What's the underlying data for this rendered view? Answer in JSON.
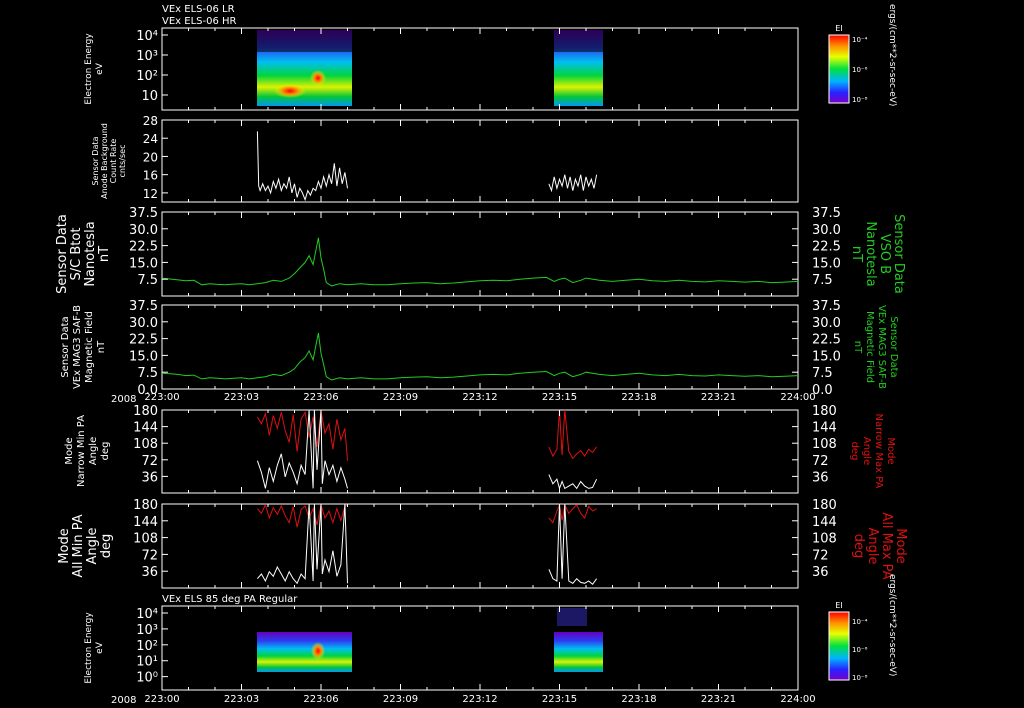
{
  "header": {
    "line1": "VEx ELS-06 LR",
    "line2": "VEx ELS-06 HR"
  },
  "colors": {
    "frame": "#ffffff",
    "green": "#22cc22",
    "red": "#dd1111",
    "background": "#000000"
  },
  "colorbar": {
    "title": "EI",
    "ticks": [
      "10⁻⁴",
      "10⁻⁶",
      "10⁻⁸"
    ],
    "unit": "ergs/(cm**2-sr-sec-eV)"
  },
  "chart_data": [
    {
      "type": "heatmap",
      "ylabel": [
        "Electron Energy",
        "eV"
      ],
      "log_y": true,
      "y_ticks": [
        "10⁴",
        "10³",
        "10²",
        "10"
      ],
      "intervals": [
        [
          "223:03.6",
          "223:07.0"
        ],
        [
          "223:14.6",
          "223:16.4"
        ]
      ],
      "colorbar": "EI"
    },
    {
      "type": "line",
      "ylabel": [
        "Sensor Data",
        "Anode Background",
        "Count Rate",
        "cnts/sec"
      ],
      "ylim": [
        10,
        28
      ],
      "y_ticks": [
        12,
        16,
        20,
        24,
        28
      ],
      "series": [
        {
          "color": "#ffffff",
          "x": [
            3.6,
            3.65,
            3.7,
            3.8,
            3.9,
            4.0,
            4.1,
            4.2,
            4.3,
            4.4,
            4.5,
            4.6,
            4.7,
            4.8,
            4.9,
            5.0,
            5.1,
            5.2,
            5.3,
            5.4,
            5.5,
            5.6,
            5.7,
            5.8,
            5.9,
            6.0,
            6.1,
            6.2,
            6.3,
            6.4,
            6.5,
            6.6,
            6.7,
            6.8,
            6.9,
            7.0
          ],
          "y": [
            25.5,
            13.5,
            12.5,
            14.0,
            12.5,
            13.5,
            12.0,
            14.5,
            13.0,
            15.0,
            12.5,
            14.0,
            13.0,
            15.5,
            12.0,
            14.0,
            11.0,
            13.0,
            12.0,
            10.5,
            12.5,
            11.5,
            13.0,
            12.5,
            14.5,
            13.0,
            15.5,
            13.5,
            16.0,
            14.0,
            18.5,
            13.5,
            17.5,
            14.0,
            16.5,
            13.0
          ]
        },
        {
          "color": "#ffffff",
          "x": [
            14.6,
            14.7,
            14.8,
            14.9,
            15.0,
            15.1,
            15.2,
            15.3,
            15.4,
            15.5,
            15.6,
            15.7,
            15.8,
            15.9,
            16.0,
            16.1,
            16.2,
            16.3,
            16.4
          ],
          "y": [
            14.0,
            12.5,
            15.5,
            13.0,
            15.0,
            13.5,
            16.0,
            13.0,
            15.5,
            12.5,
            15.0,
            13.5,
            16.0,
            12.5,
            15.5,
            13.5,
            15.0,
            13.0,
            16.0
          ]
        }
      ]
    },
    {
      "type": "line",
      "ylabel": [
        "Sensor Data",
        "S/C Btot",
        "Nanotesla",
        "nT"
      ],
      "ylabel_right": [
        "Sensor Data",
        "VSO B",
        "Nanotesla",
        "nT"
      ],
      "ylim": [
        0,
        37.5
      ],
      "y_ticks": [
        "7.5",
        "15.0",
        "22.5",
        "30.0",
        "37.5"
      ],
      "series": [
        {
          "color": "#22cc22",
          "x": [
            0.0,
            0.3,
            0.6,
            0.9,
            1.2,
            1.5,
            1.8,
            2.1,
            2.4,
            2.7,
            3.0,
            3.3,
            3.6,
            3.9,
            4.2,
            4.5,
            4.8,
            5.0,
            5.2,
            5.4,
            5.55,
            5.7,
            5.8,
            5.9,
            6.0,
            6.1,
            6.2,
            6.4,
            6.7,
            7.0,
            7.5,
            8.0,
            8.5,
            9.0,
            9.5,
            10.0,
            10.5,
            11.0,
            11.5,
            12.0,
            12.5,
            13.0,
            13.5,
            14.0,
            14.5,
            14.8,
            15.0,
            15.2,
            15.5,
            15.8,
            16.0,
            16.5,
            17.0,
            17.5,
            18.0,
            18.5,
            19.0,
            19.5,
            20.0,
            20.5,
            21.0,
            21.5,
            22.0,
            22.5,
            23.0,
            23.5,
            24.0
          ],
          "y": [
            8.0,
            7.6,
            7.2,
            6.8,
            7.0,
            5.0,
            5.5,
            5.2,
            5.0,
            5.3,
            5.5,
            5.0,
            5.5,
            6.0,
            7.0,
            6.5,
            8.0,
            10.0,
            12.5,
            15.0,
            18.0,
            14.0,
            20.0,
            26.0,
            17.0,
            12.0,
            6.0,
            4.5,
            5.5,
            5.0,
            5.5,
            5.0,
            5.0,
            5.5,
            5.8,
            6.0,
            5.5,
            5.8,
            6.3,
            6.8,
            7.0,
            6.8,
            7.5,
            8.0,
            8.3,
            6.5,
            7.5,
            8.0,
            6.0,
            7.0,
            8.0,
            7.0,
            6.5,
            7.0,
            7.5,
            6.8,
            6.5,
            7.0,
            6.5,
            6.3,
            6.8,
            6.5,
            6.2,
            6.5,
            6.0,
            6.2,
            6.5
          ]
        }
      ]
    },
    {
      "type": "line",
      "ylabel": [
        "Sensor Data",
        "VEx MAG3 SAF-B",
        "Magnetic Field",
        "nT"
      ],
      "ylabel_right": [
        "Sensor Data",
        "VEx MAG3 SAF-B",
        "Magnetic Field",
        "nT"
      ],
      "ylim": [
        0,
        37.5
      ],
      "y_ticks": [
        "0.0",
        "7.5",
        "15.0",
        "22.5",
        "30.0",
        "37.5"
      ],
      "series": [
        {
          "color": "#22cc22",
          "x": [
            0.0,
            0.3,
            0.6,
            0.9,
            1.2,
            1.5,
            1.8,
            2.1,
            2.4,
            2.7,
            3.0,
            3.3,
            3.6,
            3.9,
            4.2,
            4.5,
            4.8,
            5.0,
            5.2,
            5.4,
            5.55,
            5.7,
            5.8,
            5.9,
            6.0,
            6.1,
            6.2,
            6.4,
            6.7,
            7.0,
            7.5,
            8.0,
            8.5,
            9.0,
            9.5,
            10.0,
            10.5,
            11.0,
            11.5,
            12.0,
            12.5,
            13.0,
            13.5,
            14.0,
            14.5,
            14.8,
            15.0,
            15.2,
            15.5,
            15.8,
            16.0,
            16.5,
            17.0,
            17.5,
            18.0,
            18.5,
            19.0,
            19.5,
            20.0,
            20.5,
            21.0,
            21.5,
            22.0,
            22.5,
            23.0,
            23.5,
            24.0
          ],
          "y": [
            7.0,
            6.8,
            6.5,
            6.0,
            6.2,
            4.5,
            5.0,
            4.8,
            4.5,
            4.8,
            5.0,
            4.5,
            5.0,
            5.5,
            6.5,
            6.0,
            7.5,
            9.0,
            12.0,
            14.0,
            17.0,
            13.0,
            19.0,
            25.0,
            16.0,
            11.0,
            5.5,
            4.0,
            5.0,
            4.5,
            5.0,
            4.5,
            4.5,
            5.0,
            5.3,
            5.5,
            5.0,
            5.3,
            5.8,
            6.3,
            6.5,
            6.3,
            7.0,
            7.5,
            7.8,
            6.0,
            7.0,
            7.5,
            5.5,
            6.5,
            7.5,
            6.5,
            6.0,
            6.5,
            7.0,
            6.3,
            6.0,
            6.5,
            6.0,
            5.8,
            6.3,
            6.0,
            5.7,
            6.0,
            5.5,
            5.7,
            6.0
          ]
        }
      ]
    },
    {
      "type": "line",
      "ylabel": [
        "Mode",
        "Narrow Min PA",
        "Angle",
        "deg"
      ],
      "ylabel_right": [
        "Mode",
        "Narrow Max PA",
        "Angle",
        "deg"
      ],
      "ylim": [
        0,
        180
      ],
      "y_ticks": [
        36,
        72,
        108,
        144,
        180
      ],
      "series": [
        {
          "color": "#dd1111",
          "x": [
            3.6,
            3.75,
            3.9,
            4.05,
            4.2,
            4.35,
            4.5,
            4.65,
            4.8,
            4.95,
            5.1,
            5.25,
            5.4,
            5.55,
            5.7,
            5.85,
            6.0,
            6.15,
            6.3,
            6.45,
            6.6,
            6.75,
            6.9,
            7.0
          ],
          "y": [
            165,
            150,
            172,
            125,
            168,
            140,
            175,
            135,
            110,
            170,
            90,
            160,
            175,
            120,
            165,
            100,
            178,
            130,
            150,
            95,
            160,
            115,
            140,
            70
          ]
        },
        {
          "color": "#dd1111",
          "x": [
            14.6,
            14.75,
            14.9,
            15.0,
            15.1,
            15.2,
            15.35,
            15.5,
            15.65,
            15.8,
            15.95,
            16.1,
            16.25,
            16.4
          ],
          "y": [
            100,
            80,
            95,
            180,
            82,
            180,
            90,
            75,
            85,
            92,
            80,
            95,
            88,
            100
          ]
        },
        {
          "color": "#ffffff",
          "x": [
            3.6,
            3.75,
            3.9,
            4.05,
            4.2,
            4.35,
            4.5,
            4.65,
            4.8,
            4.95,
            5.1,
            5.25,
            5.4,
            5.55,
            5.7,
            5.75,
            5.85,
            6.0,
            6.05,
            6.15,
            6.3,
            6.45,
            6.6,
            6.75,
            6.9,
            7.0
          ],
          "y": [
            70,
            45,
            10,
            55,
            25,
            60,
            85,
            35,
            65,
            45,
            20,
            60,
            40,
            180,
            10,
            180,
            50,
            180,
            20,
            70,
            40,
            60,
            25,
            55,
            30,
            10
          ]
        },
        {
          "color": "#ffffff",
          "x": [
            14.6,
            14.75,
            14.9,
            15.0,
            15.1,
            15.2,
            15.35,
            15.5,
            15.65,
            15.8,
            15.95,
            16.1,
            16.25,
            16.4
          ],
          "y": [
            40,
            20,
            30,
            10,
            25,
            10,
            15,
            20,
            10,
            25,
            15,
            10,
            12,
            30
          ]
        }
      ]
    },
    {
      "type": "line",
      "ylabel": [
        "Mode",
        "All Min PA",
        "Angle",
        "deg"
      ],
      "ylabel_right": [
        "Mode",
        "All Max PA",
        "Angle",
        "deg"
      ],
      "ylim": [
        0,
        180
      ],
      "y_ticks": [
        36,
        72,
        108,
        144,
        180
      ],
      "series": [
        {
          "color": "#dd1111",
          "x": [
            3.6,
            3.75,
            3.9,
            4.05,
            4.2,
            4.35,
            4.5,
            4.65,
            4.8,
            4.95,
            5.1,
            5.25,
            5.4,
            5.55,
            5.7,
            5.85,
            6.0,
            6.15,
            6.3,
            6.45,
            6.6,
            6.75,
            6.9,
            7.0
          ],
          "y": [
            170,
            160,
            178,
            150,
            172,
            158,
            176,
            155,
            140,
            174,
            130,
            168,
            176,
            150,
            170,
            135,
            178,
            150,
            165,
            140,
            170,
            145,
            175,
            178
          ]
        },
        {
          "color": "#dd1111",
          "x": [
            14.6,
            14.75,
            14.9,
            15.0,
            15.1,
            15.2,
            15.35,
            15.5,
            15.65,
            15.8,
            15.95,
            16.1,
            16.25,
            16.4
          ],
          "y": [
            150,
            140,
            165,
            178,
            145,
            178,
            160,
            170,
            178,
            160,
            150,
            175,
            165,
            170
          ]
        },
        {
          "color": "#ffffff",
          "x": [
            3.6,
            3.75,
            3.9,
            4.05,
            4.2,
            4.35,
            4.5,
            4.65,
            4.8,
            4.95,
            5.1,
            5.25,
            5.4,
            5.55,
            5.7,
            5.75,
            5.85,
            6.0,
            6.05,
            6.15,
            6.3,
            6.45,
            6.6,
            6.75,
            6.9,
            7.0
          ],
          "y": [
            20,
            30,
            15,
            35,
            25,
            45,
            30,
            15,
            35,
            20,
            10,
            30,
            20,
            180,
            15,
            180,
            40,
            180,
            30,
            60,
            35,
            80,
            25,
            50,
            180,
            10
          ]
        },
        {
          "color": "#ffffff",
          "x": [
            14.6,
            14.75,
            14.9,
            15.0,
            15.1,
            15.2,
            15.35,
            15.5,
            15.65,
            15.8,
            15.95,
            16.1,
            16.25,
            16.4
          ],
          "y": [
            40,
            20,
            15,
            180,
            20,
            180,
            15,
            10,
            20,
            12,
            10,
            15,
            8,
            20
          ]
        }
      ]
    },
    {
      "type": "heatmap",
      "title": "VEx ELS 85 deg PA Regular",
      "ylabel": [
        "Electron Energy",
        "eV"
      ],
      "log_y": true,
      "y_ticks": [
        "10⁴",
        "10³",
        "10²",
        "10¹",
        "10⁰"
      ],
      "intervals": [
        [
          "223:03.6",
          "223:07.0"
        ],
        [
          "223:14.6",
          "223:16.4"
        ]
      ],
      "colorbar": "EI"
    }
  ],
  "x_axis": {
    "year": "2008",
    "range_minutes": [
      0,
      24
    ],
    "tick_labels": [
      "223:00",
      "223:03",
      "223:06",
      "223:09",
      "223:12",
      "223:15",
      "223:18",
      "223:21",
      "224:00"
    ]
  }
}
